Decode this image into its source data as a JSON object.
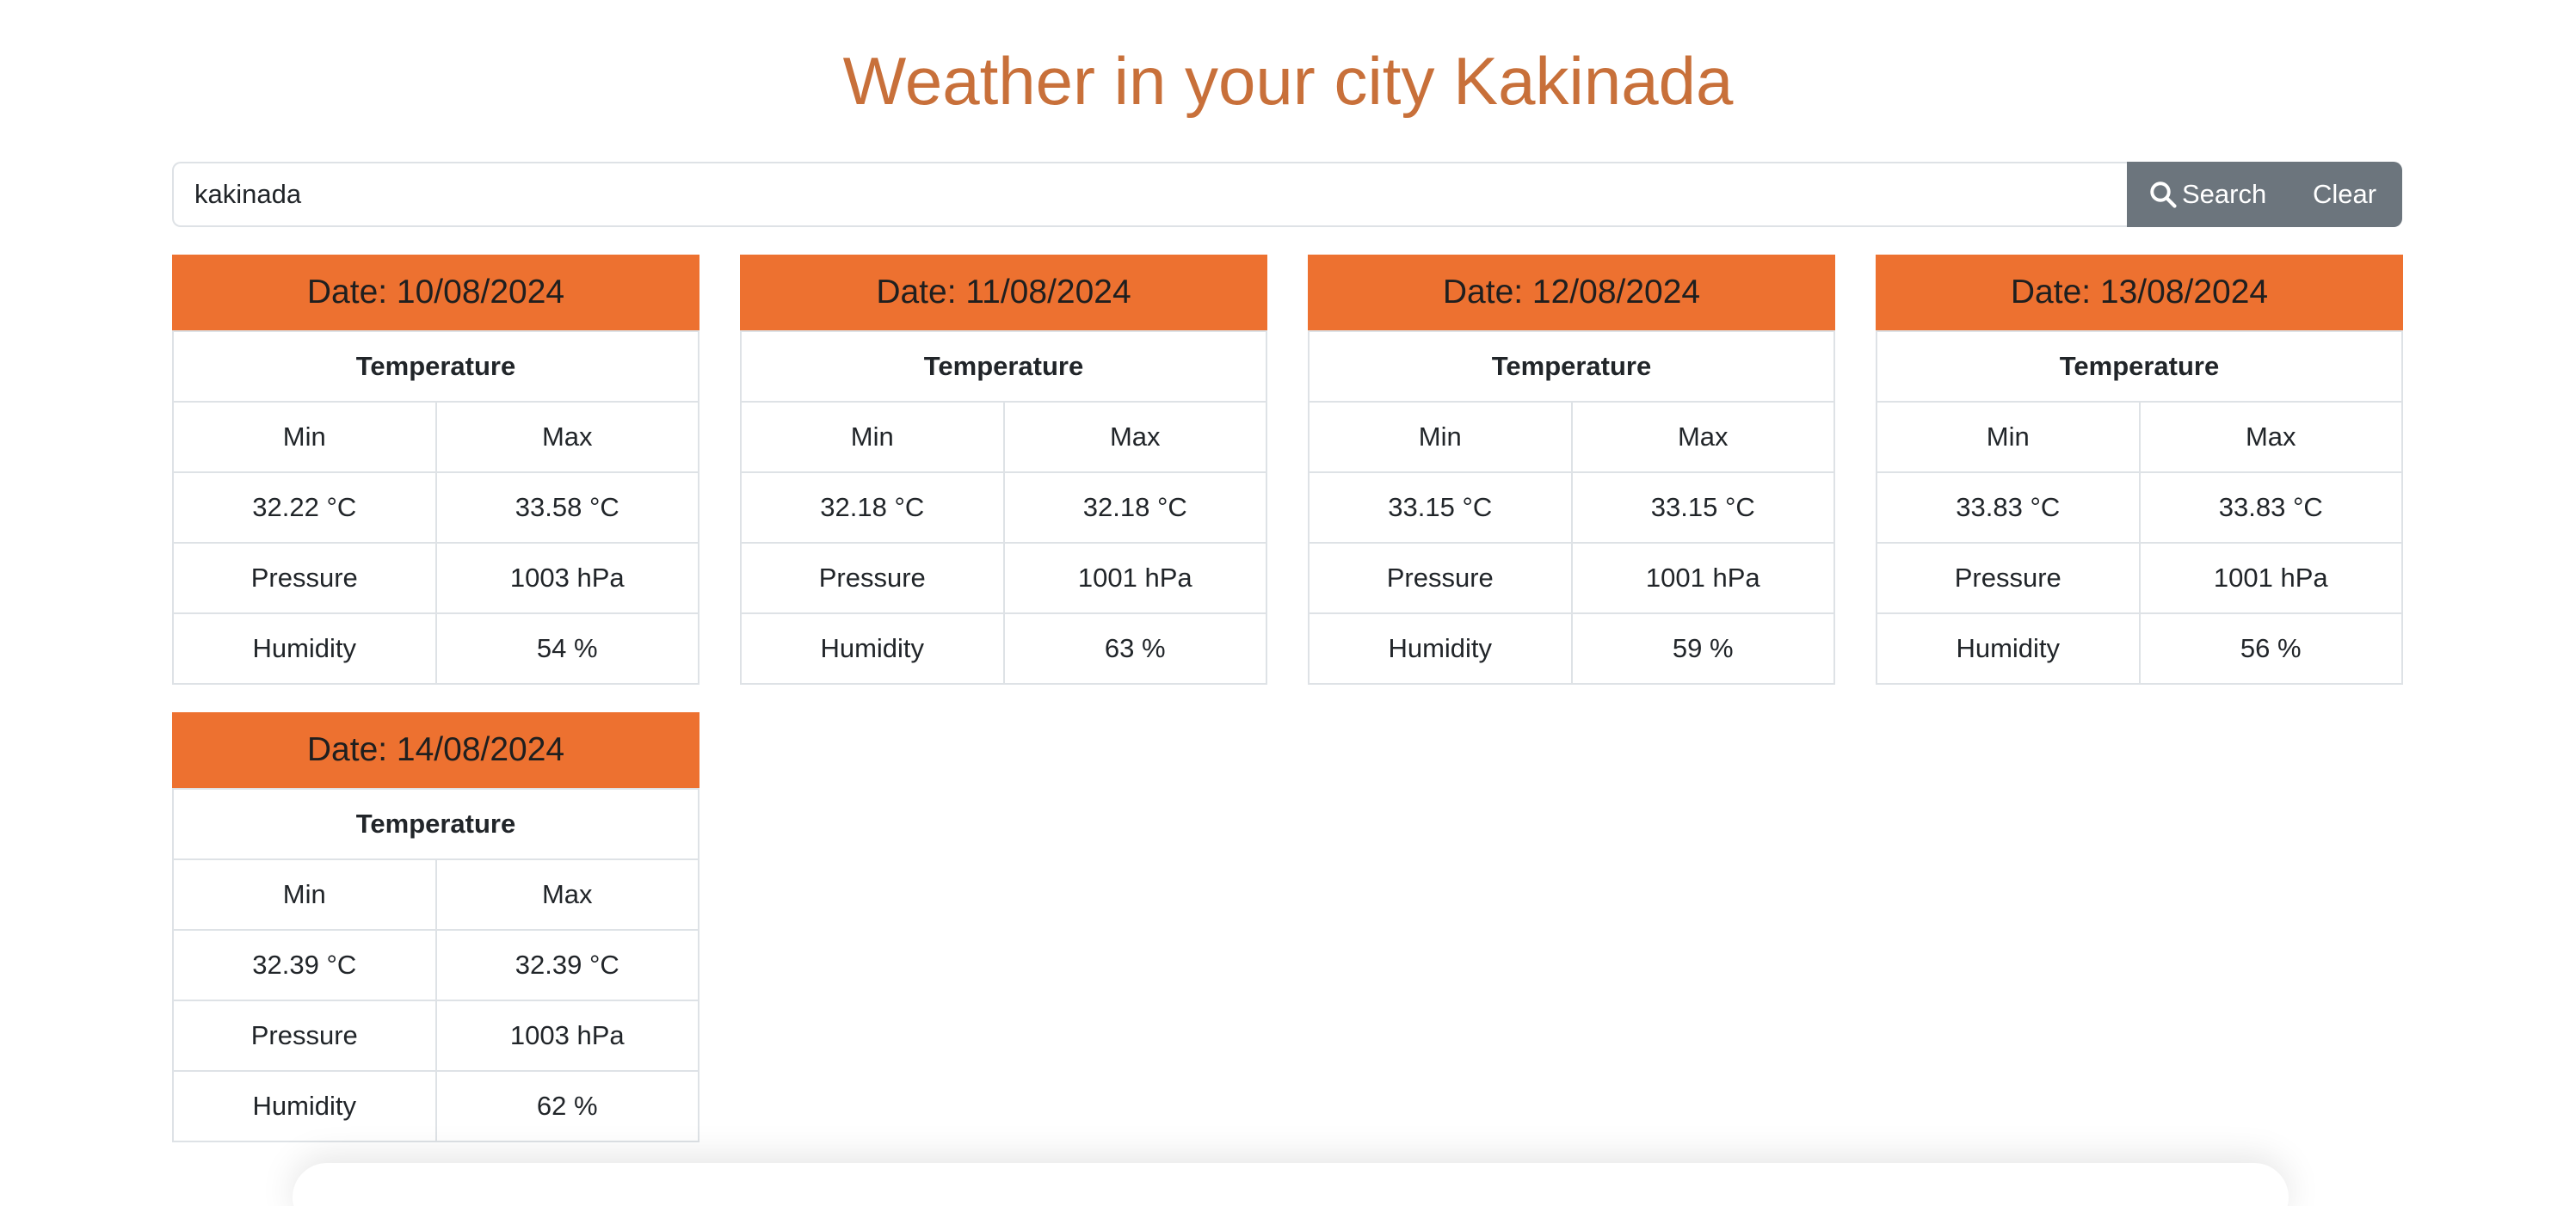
{
  "header": {
    "title": "Weather in your city Kakinada"
  },
  "search": {
    "value": "kakinada",
    "search_label": "Search",
    "clear_label": "Clear"
  },
  "labels": {
    "temperature": "Temperature",
    "min": "Min",
    "max": "Max",
    "pressure": "Pressure",
    "humidity": "Humidity"
  },
  "forecast": [
    {
      "date": "Date: 10/08/2024",
      "min": "32.22 °C",
      "max": "33.58 °C",
      "pressure": "1003 hPa",
      "humidity": "54 %"
    },
    {
      "date": "Date: 11/08/2024",
      "min": "32.18 °C",
      "max": "32.18 °C",
      "pressure": "1001 hPa",
      "humidity": "63 %"
    },
    {
      "date": "Date: 12/08/2024",
      "min": "33.15 °C",
      "max": "33.15 °C",
      "pressure": "1001 hPa",
      "humidity": "59 %"
    },
    {
      "date": "Date: 13/08/2024",
      "min": "33.83 °C",
      "max": "33.83 °C",
      "pressure": "1001 hPa",
      "humidity": "56 %"
    },
    {
      "date": "Date: 14/08/2024",
      "min": "32.39 °C",
      "max": "32.39 °C",
      "pressure": "1003 hPa",
      "humidity": "62 %"
    }
  ],
  "colors": {
    "title": "#c8703a",
    "card_header": "#ed7130",
    "button_group": "#6c757d"
  }
}
